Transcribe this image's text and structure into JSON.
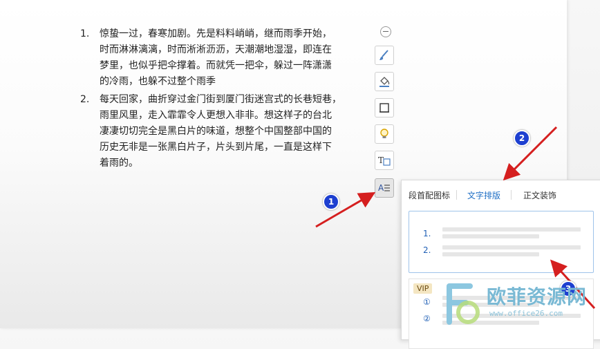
{
  "document": {
    "items": [
      {
        "num": "1.",
        "text": "惊蛰一过，春寒加剧。先是料料峭峭，继而雨季开始，\n时而淋淋漓漓，时而淅淅沥沥，天潮潮地湿湿，即连在\n梦里，也似乎把伞撑着。而就凭一把伞，躲过一阵潇潇\n的冷雨，也躲不过整个雨季"
      },
      {
        "num": "2.",
        "text": "每天回家，曲折穿过金门街到厦门街迷宫式的长巷短巷，\n雨里风里，走入霏霏令人更想入非非。想这样子的台北\n凄凄切切完全是黑白片的味道，想整个中国整部中国的\n历史无非是一张黑白片子，片头到片尾，一直是这样下\n着雨的。"
      }
    ]
  },
  "toolbar": {
    "icons": [
      "collapse-icon",
      "brush-icon",
      "fill-bucket-icon",
      "frame-icon",
      "bulb-icon",
      "text-box-icon",
      "text-layout-icon"
    ]
  },
  "panel": {
    "tabs": [
      {
        "label": "段首配图标",
        "active": false
      },
      {
        "label": "文字排版",
        "active": true
      },
      {
        "label": "正文装饰",
        "active": false
      }
    ],
    "layout_numbers": [
      "1.",
      "2."
    ],
    "vip_label": "VIP",
    "vip_numbers": [
      "①",
      "②"
    ]
  },
  "annotations": {
    "badges": [
      "1",
      "2",
      "3"
    ],
    "color": "#d51f1f"
  },
  "watermark": {
    "title": "欧菲资源网",
    "url": "www.office26.com"
  },
  "colors": {
    "accent": "#1f6fc5",
    "badge": "#1d3fd0"
  }
}
